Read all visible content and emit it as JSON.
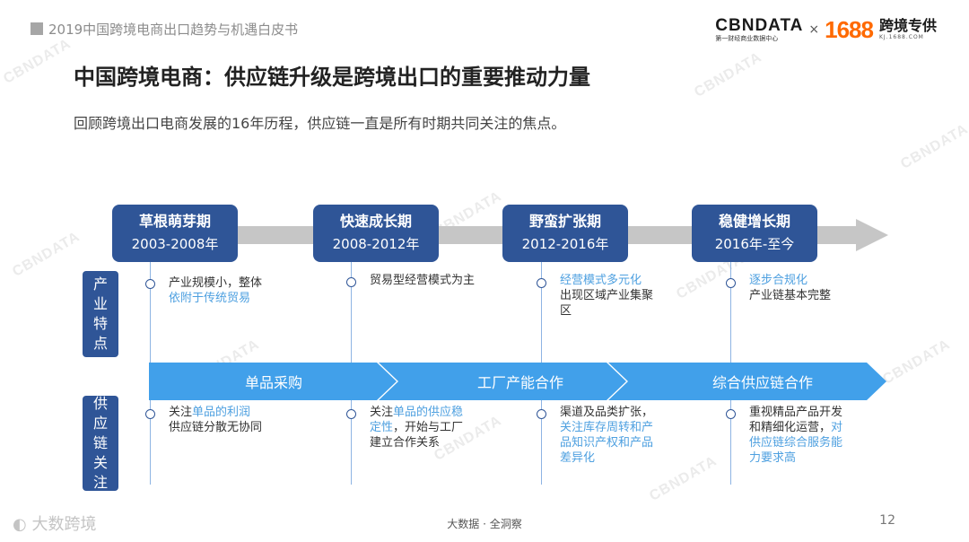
{
  "header": {
    "report_title": "2019中国跨境电商出口趋势与机遇白皮书",
    "logo_cbn": "CBNDATA",
    "logo_cbn_sub": "第一财经商业数据中心",
    "logo_times": "×",
    "logo_1688": "1688",
    "logo_kj": "跨境专供",
    "logo_kj_sub": "KJ.1688.COM"
  },
  "title": "中国跨境电商：供应链升级是跨境出口的重要推动力量",
  "subtitle": "回顾跨境出口电商发展的16年历程，供应链一直是所有时期共同关注的焦点。",
  "phases": [
    {
      "name": "草根萌芽期",
      "years": "2003-2008年"
    },
    {
      "name": "快速成长期",
      "years": "2008-2012年"
    },
    {
      "name": "野蛮扩张期",
      "years": "2012-2016年"
    },
    {
      "name": "稳健增长期",
      "years": "2016年-至今"
    }
  ],
  "side_labels": {
    "industry": [
      "产",
      "业",
      "特",
      "点"
    ],
    "supply": [
      "供",
      "应",
      "链",
      "关",
      "注"
    ]
  },
  "industry_notes": [
    {
      "plain1": "产业规模小，整体",
      "hl": "依附于传统贸易",
      "plain2": ""
    },
    {
      "plain1": "贸易型经营模式为主",
      "hl": "",
      "plain2": ""
    },
    {
      "plain1": "",
      "hl": "经营模式多元化",
      "plain2": "出现区域产业集聚区"
    },
    {
      "plain1": "",
      "hl": "逐步合规化",
      "plain2": "产业链基本完整"
    }
  ],
  "supply_stages": [
    "单品采购",
    "工厂产能合作",
    "综合供应链合作"
  ],
  "supply_notes": [
    {
      "plain1": "关注",
      "hl": "单品的利润",
      "plain2": "供应链分散无协同"
    },
    {
      "plain1": "关注",
      "hl": "单品的供应稳定性",
      "plain2": "，开始与工厂建立合作关系"
    },
    {
      "plain1": "渠道及品类扩张，",
      "hl": "关注库存周转和产品知识产权和产品差异化",
      "plain2": ""
    },
    {
      "plain1": "重视精品产品开发和精细化运营，",
      "hl": "对供应链综合服务能力要求高",
      "plain2": ""
    }
  ],
  "footer": {
    "brand": "大数跨境",
    "center": "大数据 · 全洞察",
    "page": "12"
  },
  "watermark": "CBNDATA",
  "colors": {
    "phase_box": "#2f5597",
    "chevron": "#41a0ea",
    "highlight": "#4ea0e0",
    "arrow_band": "#c6c6c6"
  }
}
